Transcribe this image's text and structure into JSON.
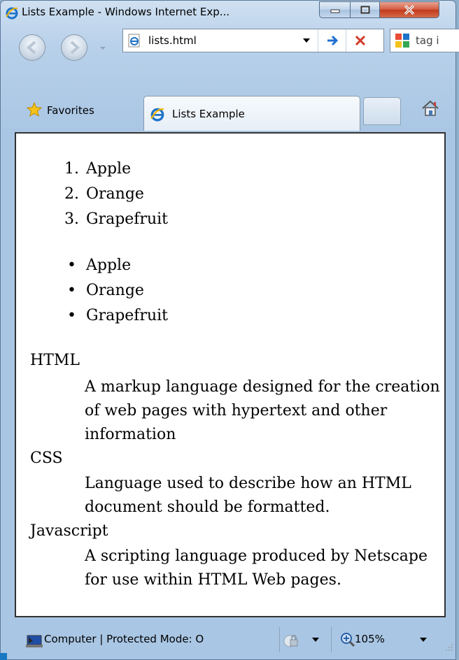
{
  "window": {
    "title": "Lists Example - Windows Internet Exp...",
    "browser_icon": "ie-icon"
  },
  "navigation": {
    "address": "lists.html",
    "search_text": "tag i",
    "back_icon": "back-arrow-icon",
    "forward_icon": "forward-arrow-icon",
    "go_icon": "go-arrow-icon",
    "stop_icon": "stop-x-icon"
  },
  "toolbar": {
    "favorites_label": "Favorites",
    "tab_label": "Lists Example"
  },
  "content": {
    "ordered_markers": [
      "1.",
      "2.",
      "3."
    ],
    "ordered": [
      "Apple",
      "Orange",
      "Grapefruit"
    ],
    "unordered_marker": "•",
    "unordered": [
      "Apple",
      "Orange",
      "Grapefruit"
    ],
    "definitions": [
      {
        "term": "HTML",
        "desc": "A markup language designed for the creation of web pages with hypertext and other information"
      },
      {
        "term": "CSS",
        "desc": "Language used to describe how an HTML document should be formatted."
      },
      {
        "term": "Javascript",
        "desc": "A scripting language produced by Netscape for use within HTML Web pages."
      }
    ]
  },
  "status": {
    "zone": "Computer | Protected Mode: O",
    "zoom": "105%"
  },
  "colors": {
    "ie_blue": "#1e73c8",
    "close_red": "#c03a1d",
    "go_blue": "#1f6fd1",
    "stop_red": "#d23a2a",
    "star_yellow": "#f4c21a"
  }
}
